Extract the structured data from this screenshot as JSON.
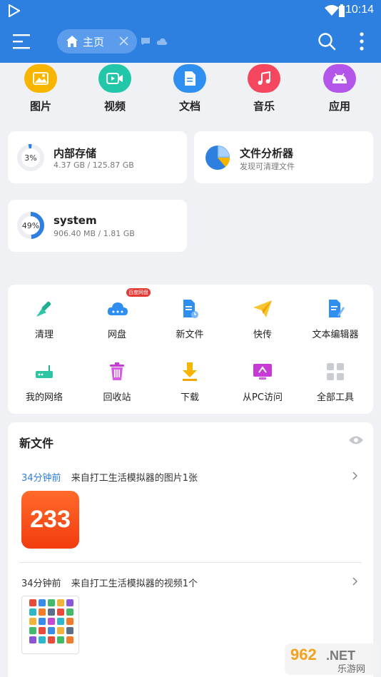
{
  "status": {
    "time": "10:14"
  },
  "toolbar": {
    "tab_label": "主页"
  },
  "categories": [
    {
      "label": "图片",
      "icon": "image-icon",
      "color": "#f7b500"
    },
    {
      "label": "视频",
      "icon": "video-icon",
      "color": "#21c7a8"
    },
    {
      "label": "文档",
      "icon": "document-icon",
      "color": "#2f8ff0"
    },
    {
      "label": "音乐",
      "icon": "music-icon",
      "color": "#f4475f"
    },
    {
      "label": "应用",
      "icon": "android-icon",
      "color": "#b255e8"
    }
  ],
  "storage": {
    "internal": {
      "title": "内部存储",
      "used": "4.37 GB / 125.87 GB",
      "percent_label": "3%",
      "percent": 3
    },
    "analyzer": {
      "title": "文件分析器",
      "sub": "发现可清理文件"
    },
    "system": {
      "title": "system",
      "used": "906.40 MB / 1.81 GB",
      "percent_label": "49%",
      "percent": 49
    }
  },
  "tools": [
    {
      "label": "清理",
      "icon": "broom-icon"
    },
    {
      "label": "网盘",
      "icon": "cloud-drive-icon",
      "badge": "百度网盘"
    },
    {
      "label": "新文件",
      "icon": "new-file-icon"
    },
    {
      "label": "快传",
      "icon": "paper-plane-icon"
    },
    {
      "label": "文本编辑器",
      "icon": "text-editor-icon"
    },
    {
      "label": "我的网络",
      "icon": "router-icon"
    },
    {
      "label": "回收站",
      "icon": "trash-icon"
    },
    {
      "label": "下载",
      "icon": "download-icon"
    },
    {
      "label": "从PC访问",
      "icon": "pc-access-icon"
    },
    {
      "label": "全部工具",
      "icon": "all-tools-icon"
    }
  ],
  "new_files": {
    "title": "新文件",
    "entries": [
      {
        "time": "34分钟前",
        "desc": "来自打工生活模拟器的图片1张",
        "thumb_text": "233"
      },
      {
        "time": "34分钟前",
        "desc": "来自打工生活模拟器的视频1个"
      }
    ]
  },
  "watermark": {
    "text": "962.NET",
    "sub": "乐游网"
  }
}
